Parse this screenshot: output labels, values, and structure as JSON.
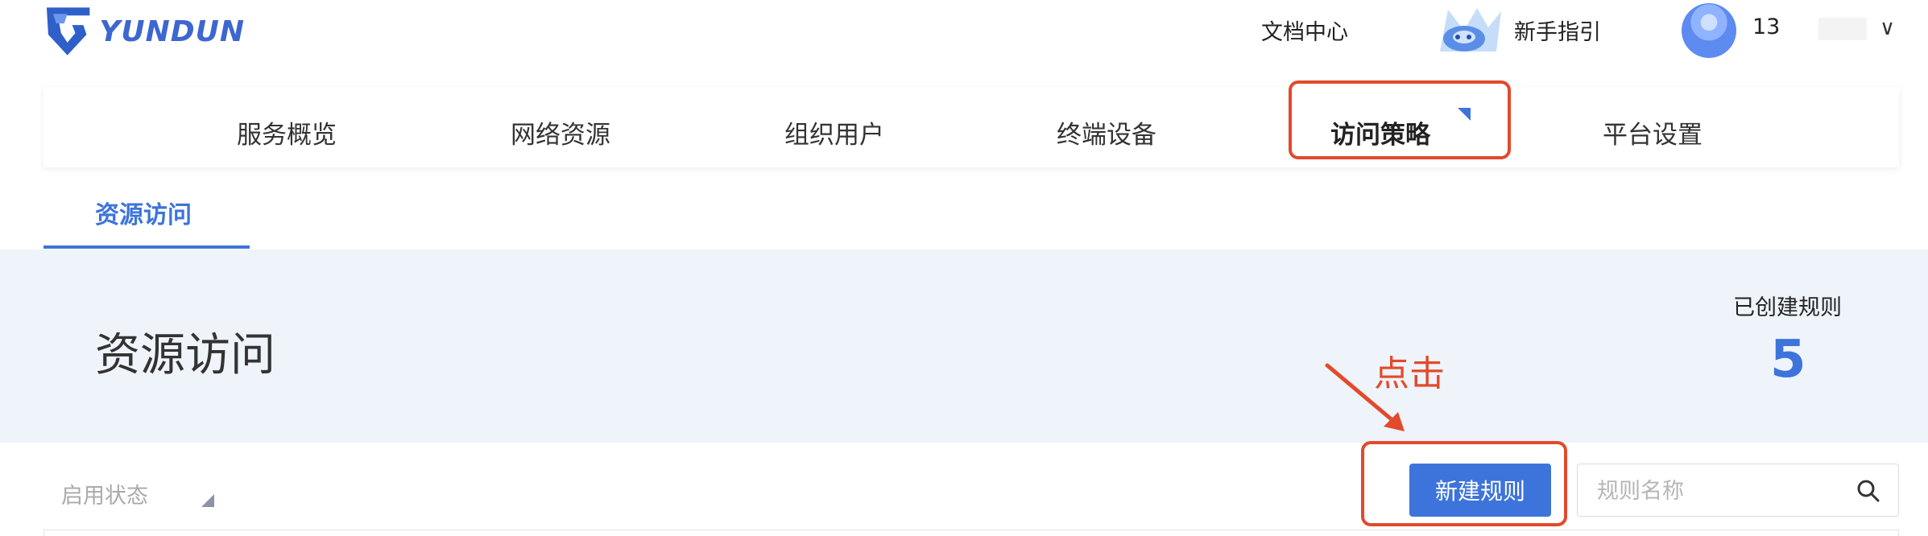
{
  "header": {
    "logo_text": "YUNDUN",
    "docs_label": "文档中心",
    "guide_label": "新手指引",
    "user_name": "13",
    "chevron": "∨"
  },
  "topnav": {
    "items": [
      {
        "label": "服务概览"
      },
      {
        "label": "网络资源"
      },
      {
        "label": "组织用户"
      },
      {
        "label": "终端设备"
      },
      {
        "label": "访问策略"
      },
      {
        "label": "平台设置"
      }
    ]
  },
  "subtab": {
    "label": "资源访问"
  },
  "banner": {
    "title": "资源访问",
    "stat_label": "已创建规则",
    "stat_value": "5"
  },
  "annotation": {
    "text": "点击"
  },
  "toolbar": {
    "filter_label": "启用状态",
    "new_rule_label": "新建规则",
    "search_placeholder": "规则名称"
  },
  "colors": {
    "accent": "#3d74db",
    "highlight": "#e24a2c",
    "banner_bg": "#eff3fa"
  }
}
